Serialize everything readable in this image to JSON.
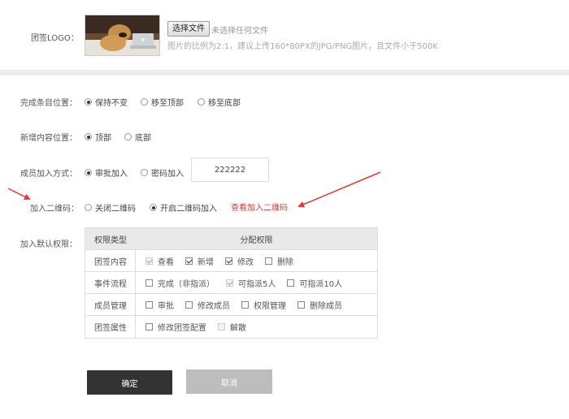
{
  "logo": {
    "label": "团签LOGO：",
    "choose_file": "选择文件",
    "no_file": "未选择任何文件",
    "hint": "图片的比例为2:1，建议上传160*80PX的JPG/PNG图片，且文件小于500K"
  },
  "complete_position": {
    "label": "完成条目位置：",
    "options": [
      "保持不变",
      "移至顶部",
      "移至底部"
    ],
    "selected": "保持不变"
  },
  "new_position": {
    "label": "新增内容位置：",
    "options": [
      "顶部",
      "底部"
    ],
    "selected": "顶部"
  },
  "join_method": {
    "label": "成员加入方式：",
    "options": [
      "审批加入",
      "密码加入"
    ],
    "selected": "审批加入",
    "password_value": "222222"
  },
  "qrcode": {
    "label": "加入二维码：",
    "options": [
      "关闭二维码",
      "开启二维码加入"
    ],
    "selected": "开启二维码加入",
    "view_link": "查看加入二维码"
  },
  "permissions": {
    "label": "加入默认权限：",
    "header_type": "权限类型",
    "header_assign": "分配权限",
    "rows": [
      {
        "type": "团签内容",
        "items": [
          {
            "label": "查看",
            "checked": true,
            "disabled": true
          },
          {
            "label": "新增",
            "checked": true,
            "disabled": false
          },
          {
            "label": "修改",
            "checked": true,
            "disabled": false
          },
          {
            "label": "删除",
            "checked": false,
            "disabled": false
          }
        ]
      },
      {
        "type": "事件流程",
        "items": [
          {
            "label": "完成（非指派）",
            "checked": false,
            "disabled": false
          },
          {
            "label": "可指派5人",
            "checked": true,
            "disabled": true
          },
          {
            "label": "可指派10人",
            "checked": false,
            "disabled": false
          }
        ]
      },
      {
        "type": "成员管理",
        "items": [
          {
            "label": "审批",
            "checked": false,
            "disabled": false
          },
          {
            "label": "修改成员",
            "checked": false,
            "disabled": false
          },
          {
            "label": "权限管理",
            "checked": false,
            "disabled": false
          },
          {
            "label": "删除成员",
            "checked": false,
            "disabled": false
          }
        ]
      },
      {
        "type": "团签属性",
        "items": [
          {
            "label": "修改团签配置",
            "checked": false,
            "disabled": false
          },
          {
            "label": "解散",
            "checked": false,
            "disabled": true
          }
        ]
      }
    ]
  },
  "actions": {
    "confirm": "确定",
    "cancel": "取消"
  },
  "colors": {
    "annotation_arrow": "#e53935",
    "link": "#d23c3c",
    "confirm_bg": "#333333",
    "cancel_bg": "#bdbdbd"
  }
}
